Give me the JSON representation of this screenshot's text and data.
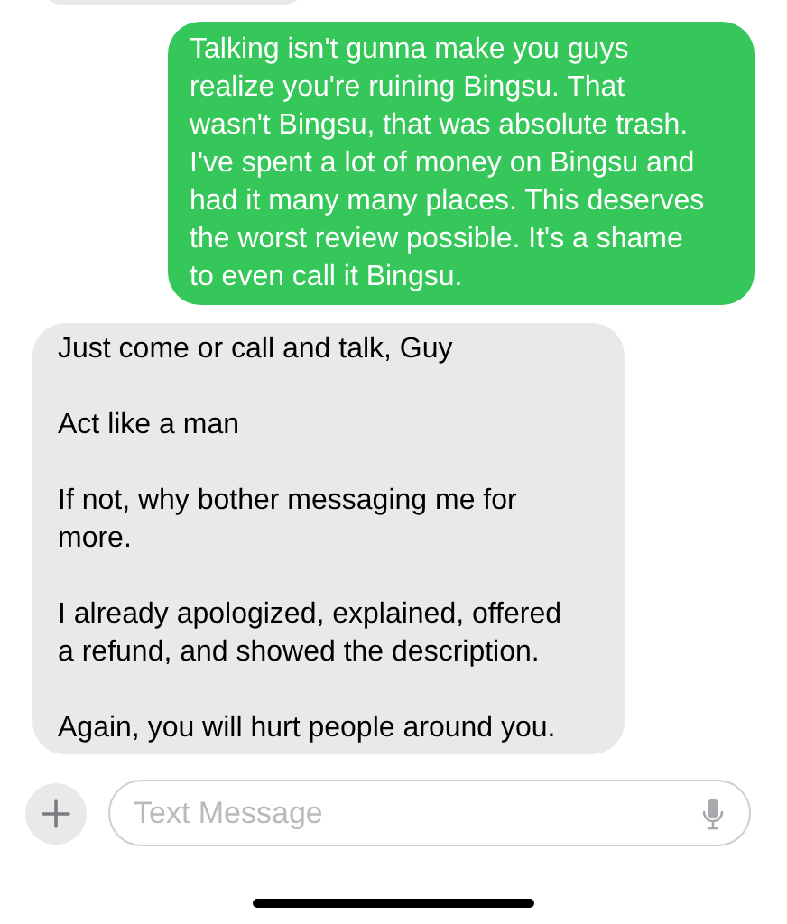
{
  "messages": [
    {
      "kind": "sent",
      "paragraphs": [
        "Talking isn't gunna make you guys realize you're ruining Bingsu. That wasn't Bingsu, that was absolute trash. I've spent a lot of money on Bingsu and had it many many places. This deserves the worst review possible. It's a shame to even call it Bingsu."
      ]
    },
    {
      "kind": "received",
      "paragraphs": [
        "Just come or call and talk, Guy",
        "Act like a man",
        "If not, why bother messaging me for more.",
        "I already apologized, explained, offered a refund, and showed the description.",
        "Again, you will hurt people around you."
      ]
    }
  ],
  "composer": {
    "placeholder": "Text Message"
  }
}
